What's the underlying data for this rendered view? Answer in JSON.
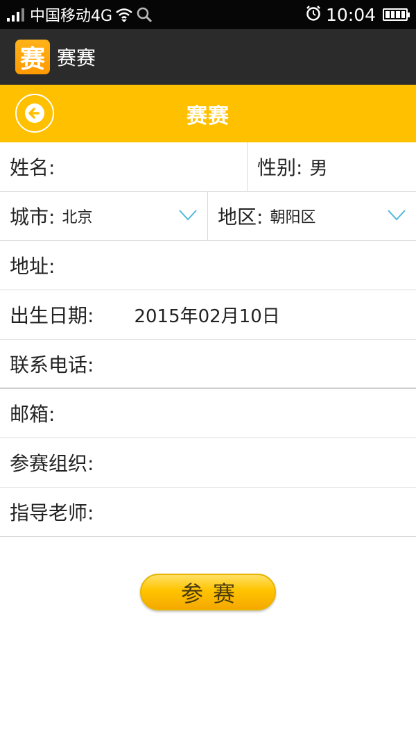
{
  "status_bar": {
    "carrier": "中国移动4G",
    "time": "10:04",
    "icons": [
      "signal-icon",
      "wifi-icon",
      "search-icon",
      "alarm-icon",
      "battery-icon"
    ]
  },
  "app_bar": {
    "logo_char": "赛",
    "title": "赛赛"
  },
  "header": {
    "title": "赛赛",
    "back_icon": "back-arrow-icon"
  },
  "form": {
    "name_label": "姓名:",
    "gender_label": "性别:",
    "gender_value": "男",
    "city_label": "城市:",
    "city_value": "北京",
    "district_label": "地区:",
    "district_value": "朝阳区",
    "address_label": "地址:",
    "birthdate_label": "出生日期:",
    "birthdate_value": "2015年02月10日",
    "phone_label": "联系电话:",
    "email_label": "邮箱:",
    "org_label": "参赛组织:",
    "teacher_label": "指导老师:"
  },
  "submit": {
    "label": "参赛"
  },
  "colors": {
    "header_yellow": "#ffc000",
    "appbar_dark": "#2b2b2b",
    "chevron_blue": "#4fb8d8"
  }
}
